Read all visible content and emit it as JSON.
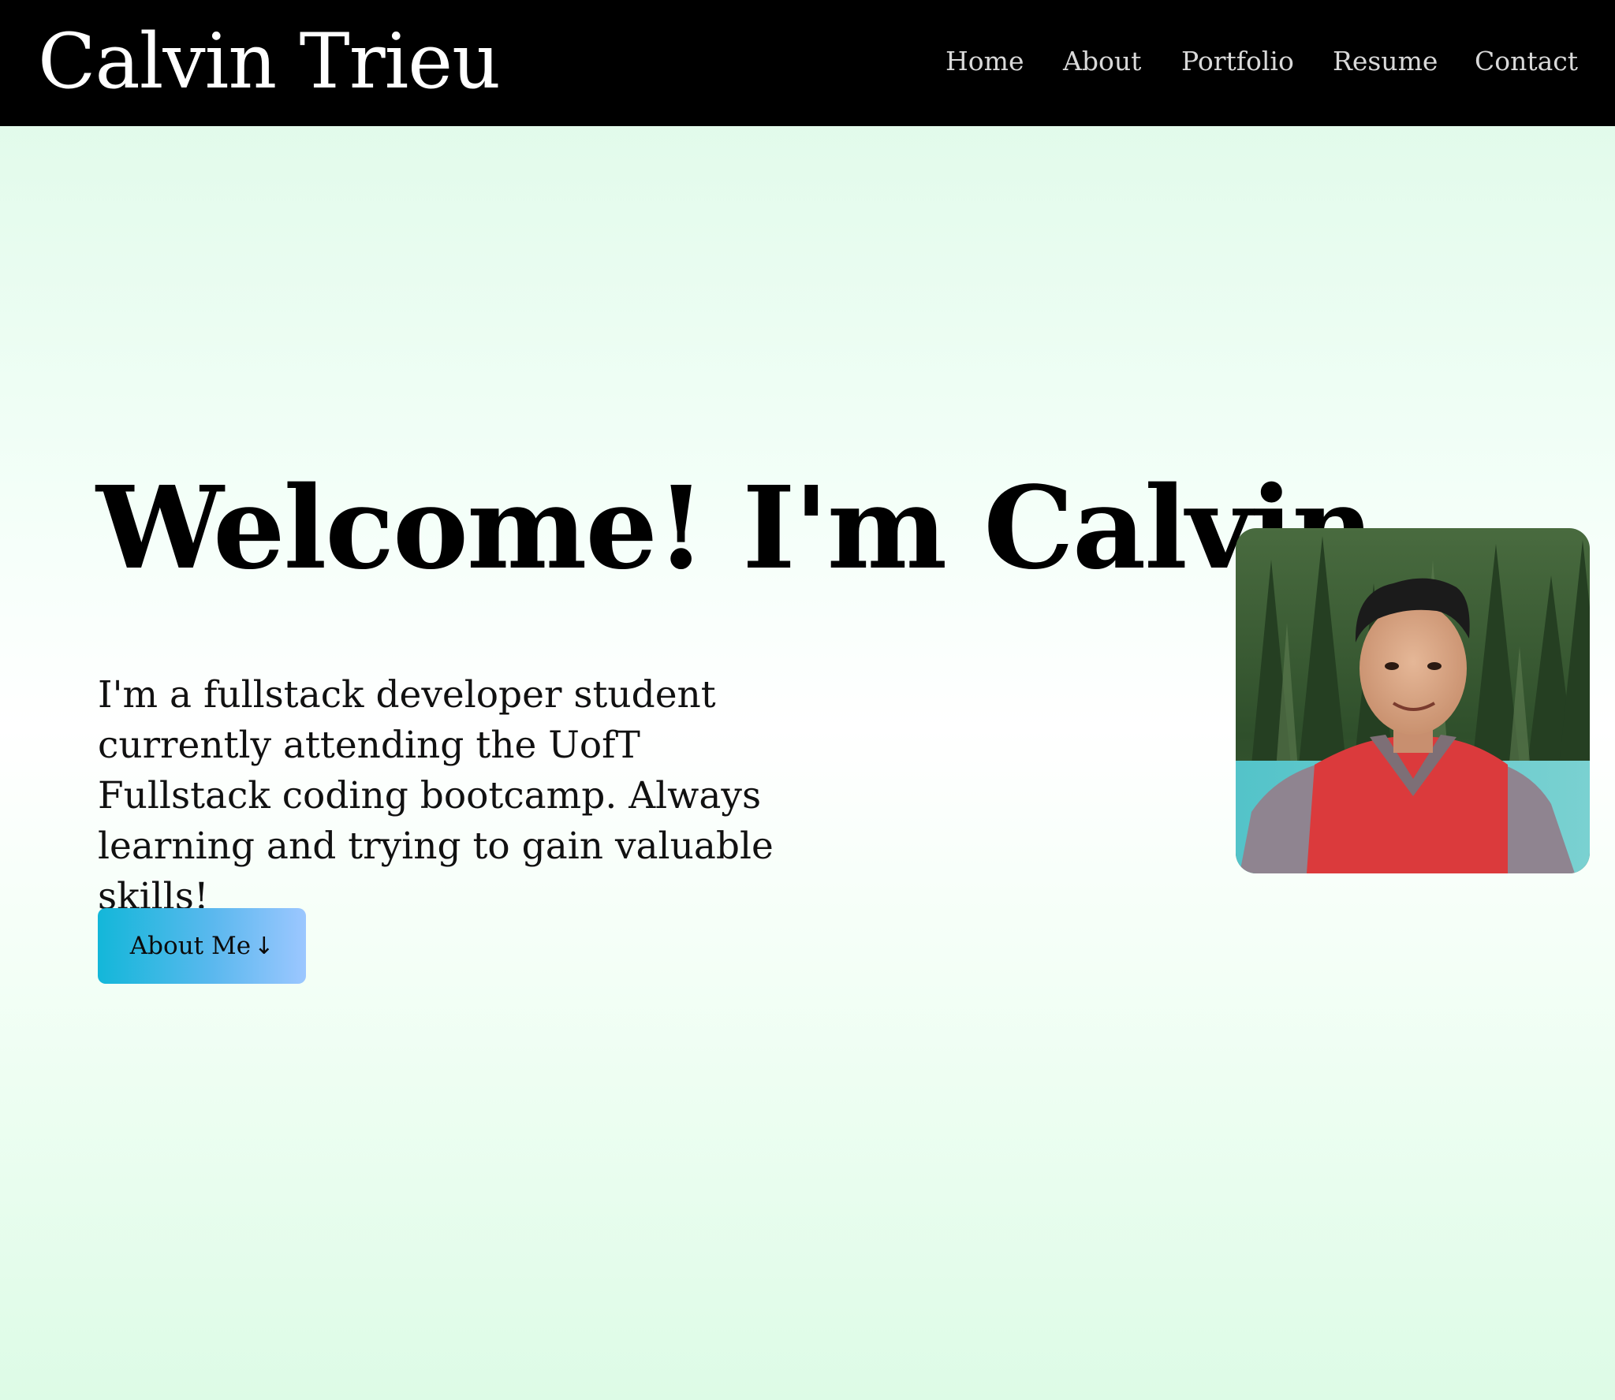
{
  "header": {
    "brand": "Calvin Trieu",
    "nav": [
      "Home",
      "About",
      "Portfolio",
      "Resume",
      "Contact"
    ]
  },
  "hero": {
    "title": "Welcome! I'm Calvin",
    "description": "I'm a fullstack developer student currently attending the UofT Fullstack coding bootcamp. Always learning and trying to gain valuable skills!",
    "button_label": "About Me",
    "button_icon": "arrow-down-icon"
  },
  "colors": {
    "navbar": "#000000",
    "nav_text": "#d9d9d9",
    "button_gradient_start": "#13b7d9",
    "button_gradient_end": "#9cc7ff",
    "background_tint": "#dcf9e6"
  }
}
